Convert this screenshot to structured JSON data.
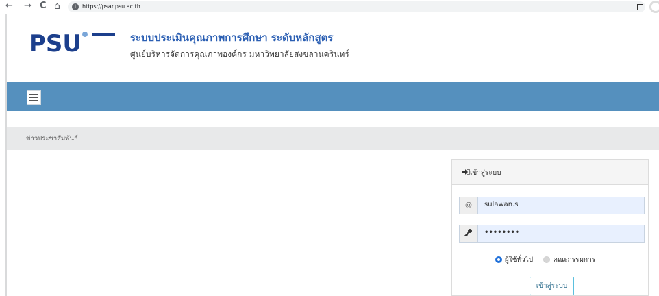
{
  "browser": {
    "url": "https://psar.psu.ac.th",
    "back_glyph": "←",
    "forward_glyph": "→",
    "reload_glyph": "C",
    "home_glyph": "⌂"
  },
  "header": {
    "logo_text": "PSU",
    "title": "ระบบประเมินคุณภาพการศึกษา ระดับหลักสูตร",
    "subtitle": "ศูนย์บริหารจัดการคุณภาพองค์กร มหาวิทยาลัยสงขลานครินทร์"
  },
  "breadcrumb": {
    "label": "ข่าวประชาสัมพันธ์"
  },
  "login": {
    "title": "เข้าสู่ระบบ",
    "username_addon": "@",
    "username_value": "sulawan.s",
    "password_value": "••••••••",
    "role_options": [
      "ผู้ใช้ทั่วไป",
      "คณะกรรมการ"
    ],
    "selected_role": "ผู้ใช้ทั่วไป",
    "submit_label": "เข้าสู่ระบบ"
  },
  "colors": {
    "navbar": "#5590be",
    "title": "#2b5fb3",
    "breadcrumb_bg": "#e8e9ea",
    "radio_selected": "#1e6fd9"
  }
}
